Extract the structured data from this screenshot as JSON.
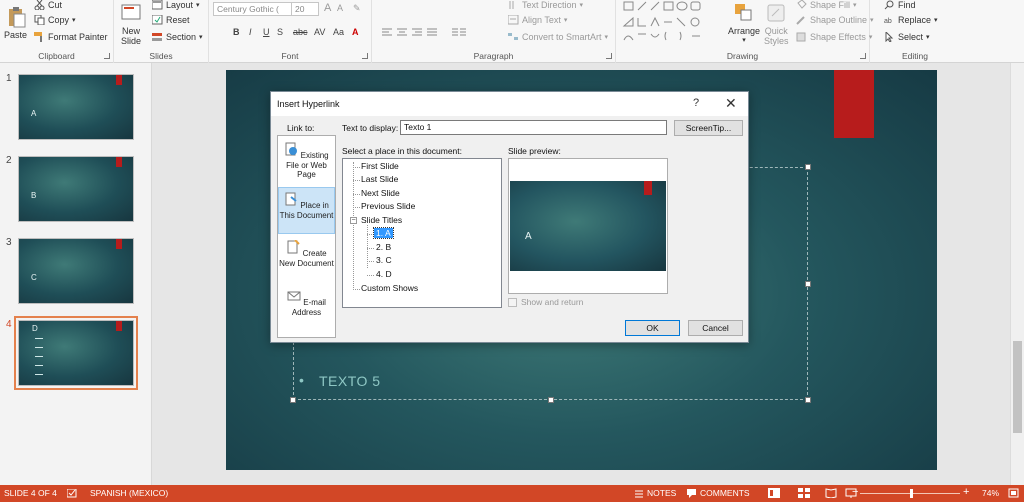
{
  "ribbon": {
    "clipboard": {
      "paste": "Paste",
      "cut": "Cut",
      "copy": "Copy",
      "format_painter": "Format Painter",
      "label": "Clipboard"
    },
    "slides": {
      "new_slide": "New\nSlide",
      "layout": "Layout",
      "reset": "Reset",
      "section": "Section",
      "label": "Slides"
    },
    "font": {
      "family": "Century Gothic (",
      "size": "20",
      "label": "Font"
    },
    "paragraph": {
      "text_direction": "Text Direction",
      "align_text": "Align Text",
      "convert_smartart": "Convert to SmartArt",
      "label": "Paragraph"
    },
    "drawing": {
      "arrange": "Arrange",
      "quick_styles": "Quick\nStyles",
      "shape_fill": "Shape Fill",
      "shape_outline": "Shape Outline",
      "shape_effects": "Shape Effects",
      "label": "Drawing"
    },
    "editing": {
      "find": "Find",
      "replace": "Replace",
      "select": "Select",
      "label": "Editing"
    }
  },
  "thumbnails": [
    {
      "num": "1",
      "label": "A"
    },
    {
      "num": "2",
      "label": "B"
    },
    {
      "num": "3",
      "label": "C"
    },
    {
      "num": "4",
      "label": "D"
    }
  ],
  "slide": {
    "body_text": "TEXTO 5"
  },
  "dialog": {
    "title": "Insert Hyperlink",
    "help": "?",
    "close": "✕",
    "link_to": "Link to:",
    "text_to_display_label": "Text to display:",
    "text_to_display_value": "Texto 1",
    "screentip": "ScreenTip...",
    "select_place_label": "Select a place in this document:",
    "slide_preview_label": "Slide preview:",
    "link_options": [
      {
        "label": "Existing File or Web Page"
      },
      {
        "label": "Place in This Document"
      },
      {
        "label": "Create New Document"
      },
      {
        "label": "E-mail Address"
      }
    ],
    "tree": {
      "first": "First Slide",
      "last": "Last Slide",
      "next": "Next Slide",
      "previous": "Previous Slide",
      "slide_titles": "Slide Titles",
      "s1": "1. A",
      "s2": "2. B",
      "s3": "3. C",
      "s4": "4. D",
      "custom_shows": "Custom Shows"
    },
    "preview_text": "A",
    "show_and_return": "Show and return",
    "ok": "OK",
    "cancel": "Cancel"
  },
  "status": {
    "slide_count": "SLIDE 4 OF 4",
    "language": "SPANISH (MEXICO)",
    "notes": "NOTES",
    "comments": "COMMENTS",
    "zoom": "74%"
  },
  "colors": {
    "accent": "#d24726",
    "slide_bg": "#24575e",
    "slide_red": "#b71c1c",
    "text_teal": "#8ec7c4"
  }
}
